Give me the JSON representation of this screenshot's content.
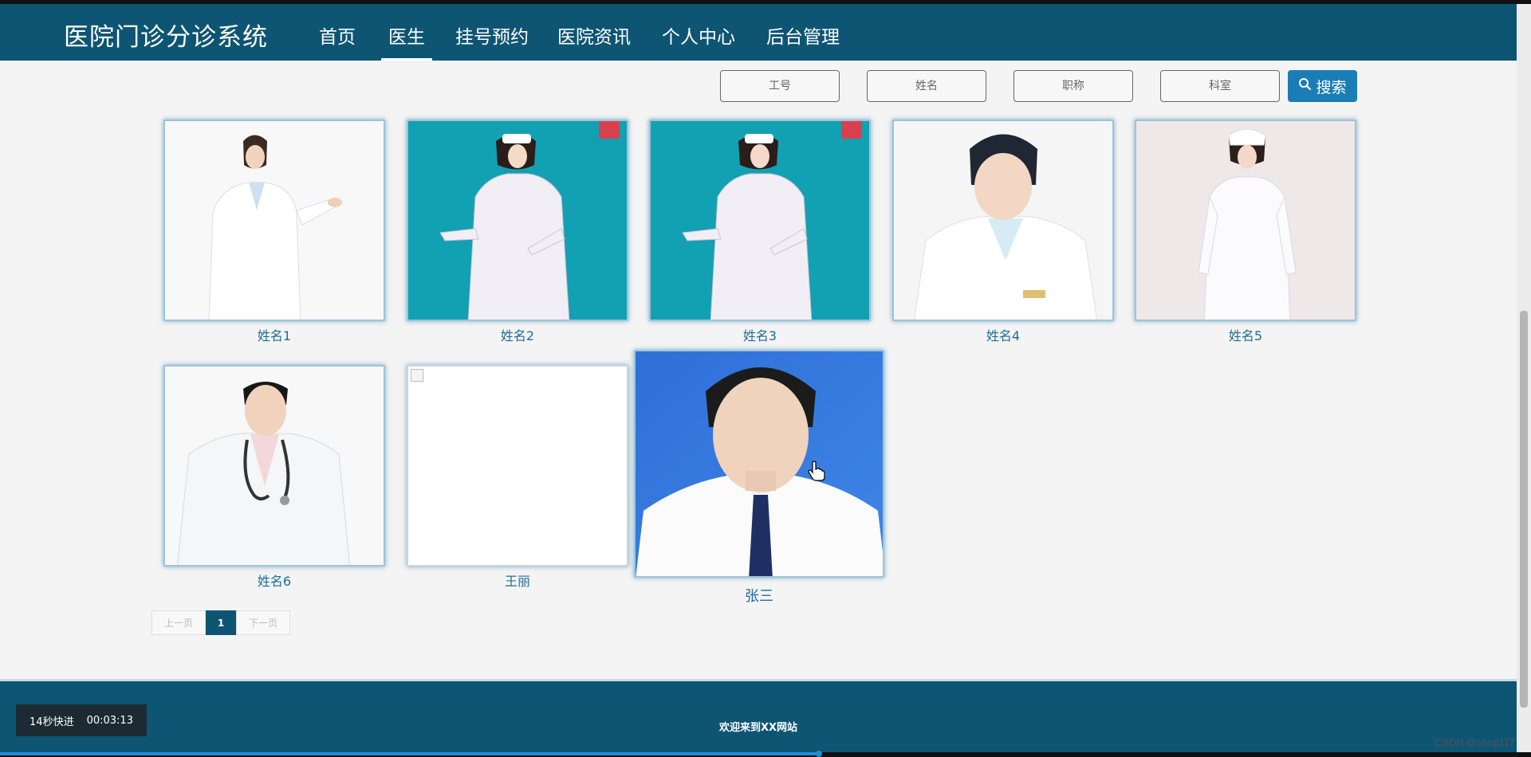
{
  "header": {
    "logo": "医院门诊分诊系统",
    "nav": [
      {
        "label": "首页",
        "active": false
      },
      {
        "label": "医生",
        "active": true
      },
      {
        "label": "挂号预约",
        "active": false
      },
      {
        "label": "医院资讯",
        "active": false
      },
      {
        "label": "个人中心",
        "active": false
      },
      {
        "label": "后台管理",
        "active": false
      }
    ]
  },
  "search": {
    "fields": [
      {
        "placeholder": "工号"
      },
      {
        "placeholder": "姓名"
      },
      {
        "placeholder": "职称"
      },
      {
        "placeholder": "科室"
      }
    ],
    "button_label": "搜索"
  },
  "doctors": [
    {
      "name": "姓名1",
      "photo": "female doctor in white coat, white background"
    },
    {
      "name": "姓名2",
      "photo": "nurse in white uniform, teal background"
    },
    {
      "name": "姓名3",
      "photo": "nurse in white uniform, teal background"
    },
    {
      "name": "姓名4",
      "photo": "female doctor portrait, white background"
    },
    {
      "name": "姓名5",
      "photo": "nurse in white uniform with cap, light background"
    },
    {
      "name": "姓名6",
      "photo": "male doctor with stethoscope, white background"
    },
    {
      "name": "王丽",
      "photo": "broken image"
    },
    {
      "name": "张三",
      "photo": "male ID photo, blue background",
      "hovered": true
    }
  ],
  "pagination": {
    "prev_label": "上一页",
    "current_page": "1",
    "next_label": "下一页"
  },
  "footer": {
    "text": "欢迎来到XX网站"
  },
  "player": {
    "skip_label": "14秒快进",
    "time": "00:03:13"
  },
  "watermark": "CSDN @sheji117",
  "colors": {
    "primary": "#0d5573",
    "accent": "#1a7db5",
    "name_text": "#1c6d98"
  }
}
